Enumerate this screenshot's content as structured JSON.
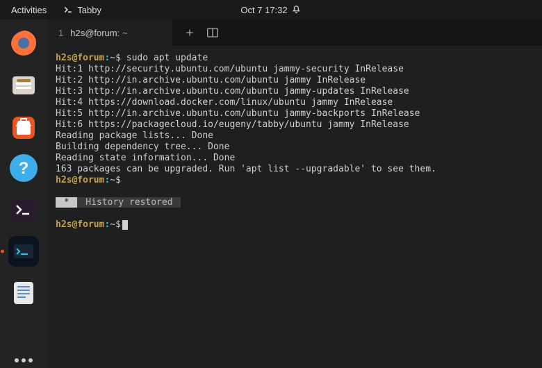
{
  "topbar": {
    "activities": "Activities",
    "app_name": "Tabby",
    "datetime": "Oct 7  17:32"
  },
  "dock": {
    "items": [
      {
        "name": "firefox-icon"
      },
      {
        "name": "files-icon"
      },
      {
        "name": "software-icon"
      },
      {
        "name": "help-icon"
      },
      {
        "name": "terminal-icon"
      },
      {
        "name": "tabby-icon"
      },
      {
        "name": "text-editor-icon"
      }
    ]
  },
  "tab": {
    "index": "1",
    "title": "h2s@forum: ~"
  },
  "prompt": {
    "user_host": "h2s@forum",
    "colon": ":",
    "tilde": "~",
    "dollar": "$"
  },
  "terminal": {
    "cmd1": " sudo apt update",
    "lines": [
      "Hit:1 http://security.ubuntu.com/ubuntu jammy-security InRelease",
      "Hit:2 http://in.archive.ubuntu.com/ubuntu jammy InRelease",
      "Hit:3 http://in.archive.ubuntu.com/ubuntu jammy-updates InRelease",
      "Hit:4 https://download.docker.com/linux/ubuntu jammy InRelease",
      "Hit:5 http://in.archive.ubuntu.com/ubuntu jammy-backports InRelease",
      "Hit:6 https://packagecloud.io/eugeny/tabby/ubuntu jammy InRelease",
      "Reading package lists... Done",
      "Building dependency tree... Done",
      "Reading state information... Done",
      "163 packages can be upgraded. Run 'apt list --upgradable' to see them."
    ],
    "history_badge": " * ",
    "history_text": " History restored "
  }
}
